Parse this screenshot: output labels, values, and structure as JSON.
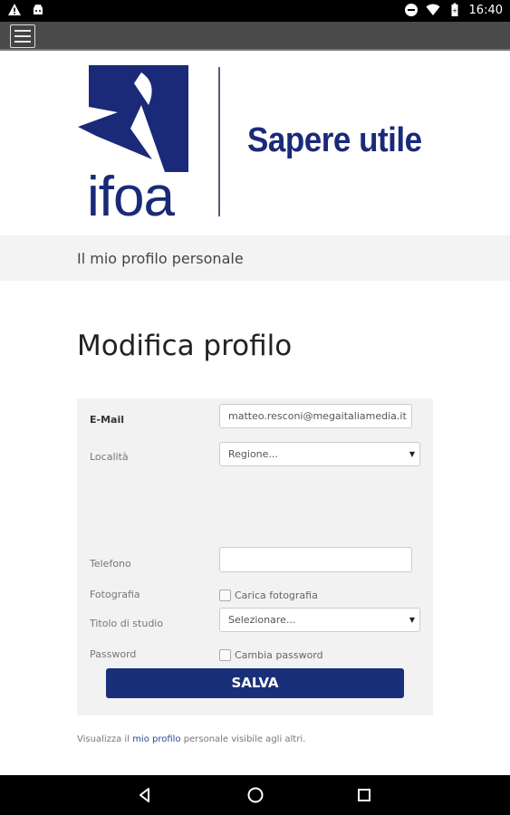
{
  "status_bar": {
    "time": "16:40",
    "left_icons": [
      "warning-icon",
      "android-icon"
    ],
    "right_icons": [
      "do-not-disturb-icon",
      "wifi-icon",
      "battery-icon"
    ]
  },
  "toolbar": {
    "menu_icon": "hamburger-menu-icon"
  },
  "logo": {
    "brand": "ifoa",
    "tagline": "Sapere utile",
    "brand_color": "#1a2a78"
  },
  "breadcrumb": {
    "text": "Il mio profilo personale"
  },
  "page": {
    "title": "Modifica profilo"
  },
  "form": {
    "email_label": "E-Mail",
    "email_value": "matteo.resconi@megaitaliamedia.it",
    "localita_label": "Località",
    "regione_placeholder": "Regione...",
    "telefono_label": "Telefono",
    "telefono_value": "",
    "fotografia_label": "Fotografia",
    "carica_fotografia_label": "Carica fotografia",
    "titolo_label": "Titolo di studio",
    "titolo_placeholder": "Selezionare...",
    "password_label": "Password",
    "cambia_password_label": "Cambia password",
    "save_label": "SALVA",
    "save_color": "#1a2f7a"
  },
  "footer": {
    "prefix": "Visualizza il",
    "link": "mio profilo",
    "suffix": "personale visibile agli altri."
  },
  "nav_bar": {
    "items": [
      "back-icon",
      "home-icon",
      "recents-icon"
    ]
  }
}
